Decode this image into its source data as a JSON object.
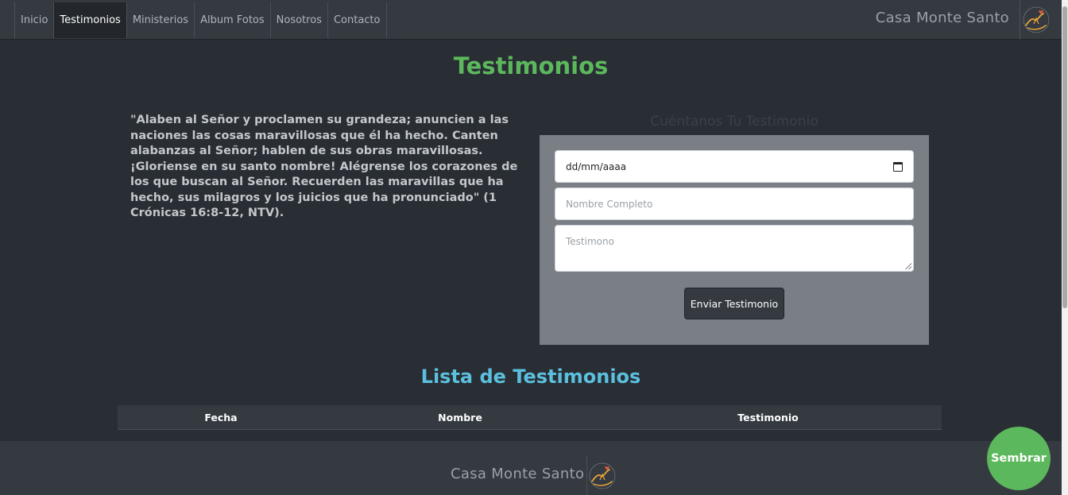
{
  "nav": {
    "items": [
      {
        "label": "Inicio"
      },
      {
        "label": "Testimonios"
      },
      {
        "label": "Ministerios"
      },
      {
        "label": "Album Fotos"
      },
      {
        "label": "Nosotros"
      },
      {
        "label": "Contacto"
      }
    ],
    "active": "Testimonios",
    "brand": "Casa Monte Santo"
  },
  "main": {
    "title": "Testimonios",
    "quote": "\"Alaben al Señor y proclamen su grandeza; anuncien a las naciones las cosas maravillosas que él ha hecho. Canten alabanzas al Señor; hablen de sus obras maravillosas. ¡Gloriense en su santo nombre! Alégrense los corazones de los que buscan al Señor. Recuerden las maravillas que ha hecho, sus milagros y los juicios que ha pronunciado\" (1 Crónicas 16:8-12, NTV)."
  },
  "form": {
    "heading": "Cuéntanos Tu Testimonio",
    "date_placeholder": "dd/mm/aaaa",
    "name_placeholder": "Nombre Completo",
    "testimony_placeholder": "Testimono",
    "submit_label": "Enviar Testimonio"
  },
  "list": {
    "title": "Lista de Testimonios",
    "columns": [
      "Fecha",
      "Nombre",
      "Testimonio"
    ]
  },
  "footer": {
    "brand": "Casa Monte Santo"
  },
  "sembrar_label": "Sembrar",
  "colors": {
    "title_green": "#5cb85c",
    "list_title_blue": "#5bc0de",
    "navbar": "#343a40",
    "background": "#292d34",
    "logo_accent": "#e8a33c",
    "logo_heart": "#e05a3a"
  }
}
